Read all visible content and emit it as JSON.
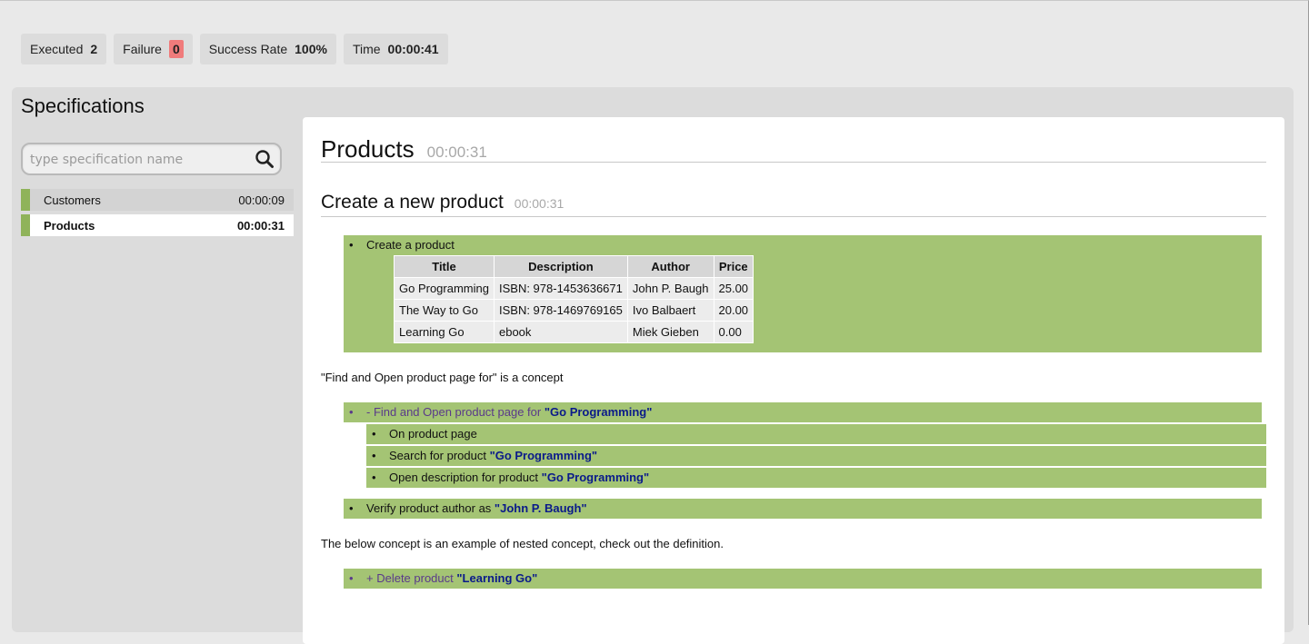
{
  "stats": {
    "executed_label": "Executed",
    "executed_value": "2",
    "failure_label": "Failure",
    "failure_value": "0",
    "success_label": "Success Rate",
    "success_value": "100%",
    "time_label": "Time",
    "time_value": "00:00:41"
  },
  "sidebar": {
    "title": "Specifications",
    "search_placeholder": "type specification name",
    "items": [
      {
        "name": "Customers",
        "time": "00:00:09"
      },
      {
        "name": "Products",
        "time": "00:00:31"
      }
    ]
  },
  "colors": {
    "pass_green": "#a4c474",
    "sidebar_pass": "#8fb35a",
    "failure_badge": "#f07b7b",
    "param_blue": "#0a1a8a",
    "concept_purple": "#5a3a8a"
  },
  "spec": {
    "title": "Products",
    "time": "00:00:31",
    "scenario": {
      "title": "Create a new product",
      "time": "00:00:31",
      "create_step": "Create a product",
      "table": {
        "headers": [
          "Title",
          "Description",
          "Author",
          "Price"
        ],
        "rows": [
          [
            "Go Programming",
            "ISBN: 978-1453636671",
            "John P. Baugh",
            "25.00"
          ],
          [
            "The Way to Go",
            "ISBN: 978-1469769165",
            "Ivo Balbaert",
            "20.00"
          ],
          [
            "Learning Go",
            "ebook",
            "Miek Gieben",
            "0.00"
          ]
        ]
      },
      "concept_note": "\"Find and Open product page for\" is a concept",
      "concept": {
        "text": "- Find and Open product page for ",
        "param": "\"Go Programming\""
      },
      "concept_steps": [
        {
          "text": "On product page",
          "param": ""
        },
        {
          "text": "Search for product ",
          "param": "\"Go Programming\""
        },
        {
          "text": "Open description for product ",
          "param": "\"Go Programming\""
        }
      ],
      "verify_step": {
        "text": "Verify product author as ",
        "param": "\"John P. Baugh\""
      },
      "nested_note": "The below concept is an example of nested concept, check out the definition.",
      "delete_concept": {
        "text": "+ Delete product ",
        "param": "\"Learning Go\""
      }
    }
  }
}
